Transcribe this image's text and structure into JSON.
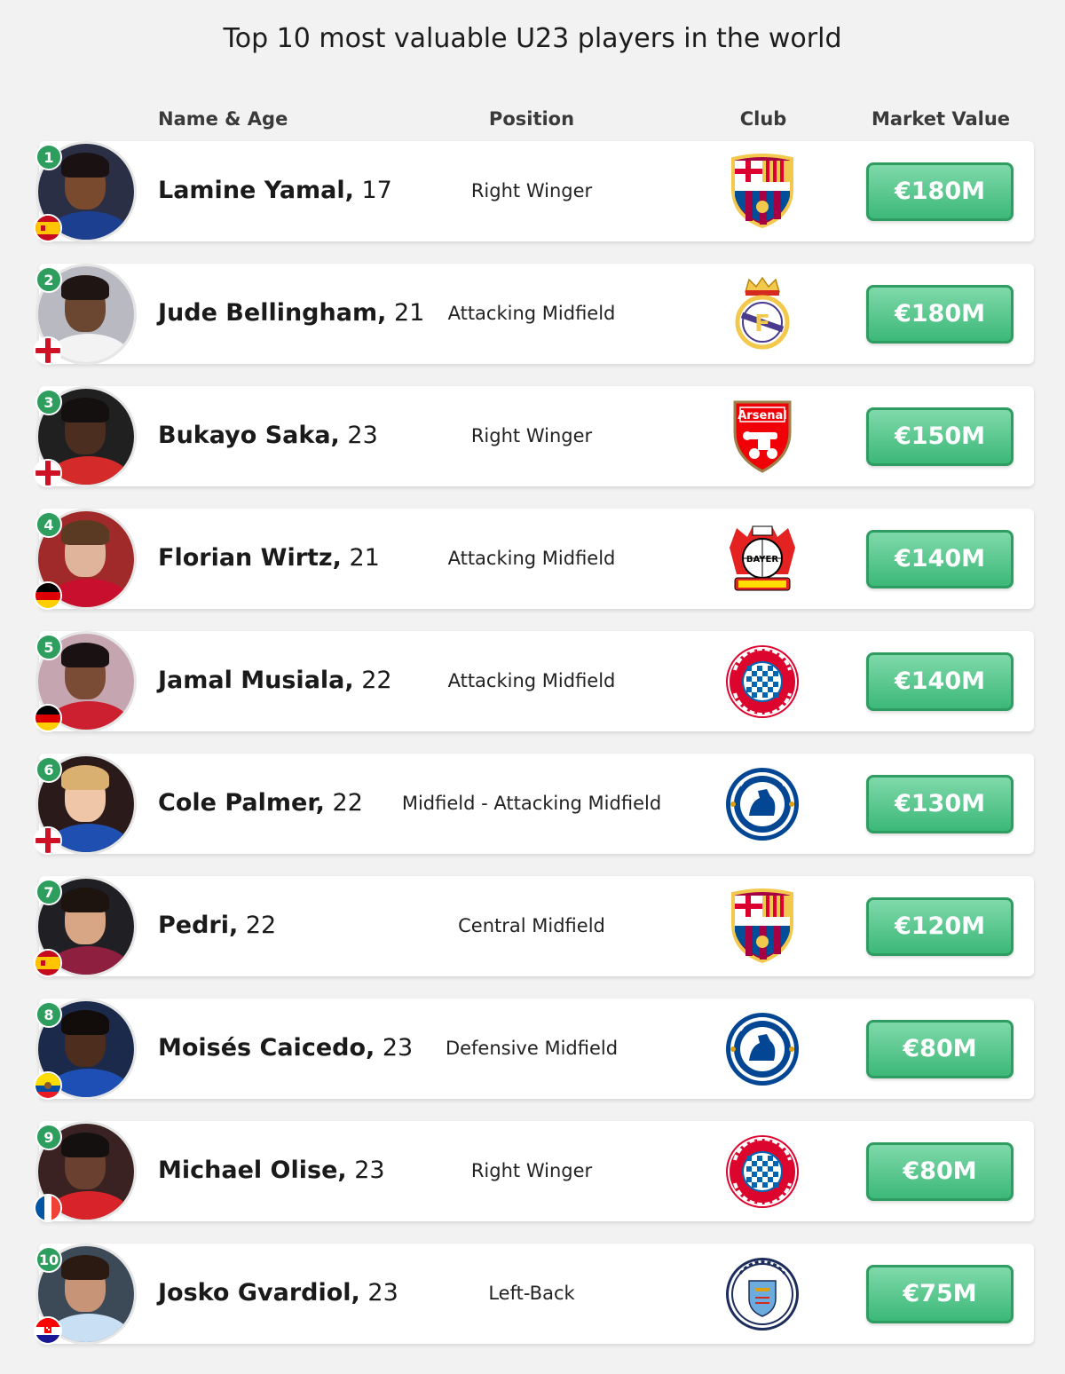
{
  "title": "Top 10 most valuable U23 players in the world",
  "headers": {
    "name_age": "Name & Age",
    "position": "Position",
    "club": "Club",
    "market_value": "Market Value"
  },
  "colors": {
    "rank_badge": "#2e9e5e",
    "value_button": "#3cb878",
    "background": "#f2f2f2"
  },
  "players": [
    {
      "rank": "1",
      "name": "Lamine Yamal,",
      "age": "17",
      "position": "Right Winger",
      "club_icon": "barcelona-crest",
      "flag_icon": "spain-flag",
      "value": "€180M"
    },
    {
      "rank": "2",
      "name": "Jude Bellingham,",
      "age": "21",
      "position": "Attacking Midfield",
      "club_icon": "real-madrid-crest",
      "flag_icon": "england-flag",
      "value": "€180M"
    },
    {
      "rank": "3",
      "name": "Bukayo Saka,",
      "age": "23",
      "position": "Right Winger",
      "club_icon": "arsenal-crest",
      "flag_icon": "england-flag",
      "value": "€150M",
      "club_text": "Arsenal"
    },
    {
      "rank": "4",
      "name": "Florian Wirtz,",
      "age": "21",
      "position": "Attacking Midfield",
      "club_icon": "leverkusen-crest",
      "flag_icon": "germany-flag",
      "value": "€140M"
    },
    {
      "rank": "5",
      "name": "Jamal Musiala,",
      "age": "22",
      "position": "Attacking Midfield",
      "club_icon": "bayern-crest",
      "flag_icon": "germany-flag",
      "value": "€140M"
    },
    {
      "rank": "6",
      "name": "Cole Palmer,",
      "age": "22",
      "position": "Midfield - Attacking Midfield",
      "club_icon": "chelsea-crest",
      "flag_icon": "england-flag",
      "value": "€130M"
    },
    {
      "rank": "7",
      "name": "Pedri,",
      "age": "22",
      "position": "Central Midfield",
      "club_icon": "barcelona-crest",
      "flag_icon": "spain-flag",
      "value": "€120M"
    },
    {
      "rank": "8",
      "name": "Moisés Caicedo,",
      "age": "23",
      "position": "Defensive Midfield",
      "club_icon": "chelsea-crest",
      "flag_icon": "ecuador-flag",
      "value": "€80M"
    },
    {
      "rank": "9",
      "name": "Michael Olise,",
      "age": "23",
      "position": "Right Winger",
      "club_icon": "bayern-crest",
      "flag_icon": "france-flag",
      "value": "€80M"
    },
    {
      "rank": "10",
      "name": "Josko Gvardiol,",
      "age": "23",
      "position": "Left-Back",
      "club_icon": "manchester-city-crest",
      "flag_icon": "croatia-flag",
      "value": "€75M"
    }
  ]
}
